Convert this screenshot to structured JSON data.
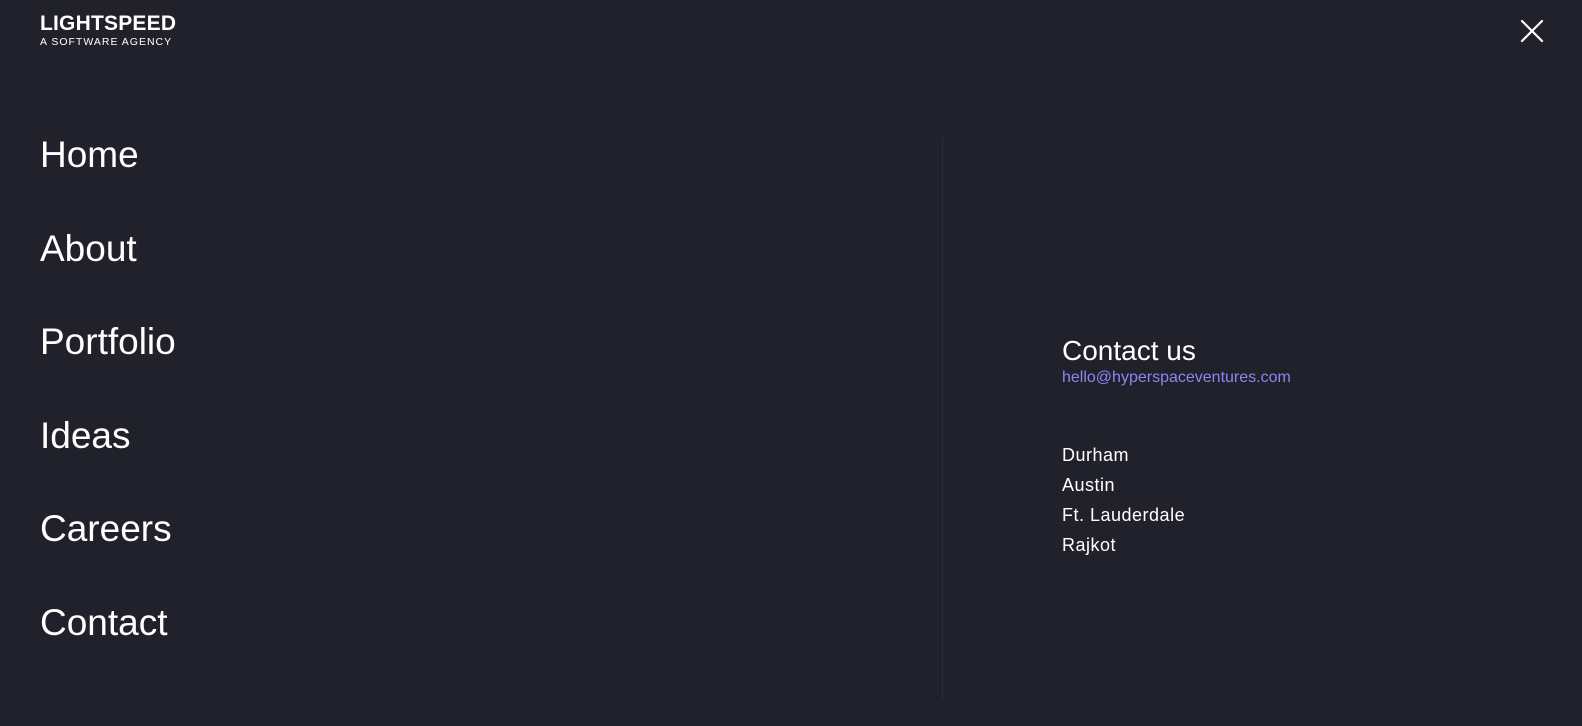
{
  "logo": {
    "name": "LIGHTSPEED",
    "tagline": "A SOFTWARE AGENCY"
  },
  "close_icon": "close-icon",
  "nav": {
    "items": [
      {
        "label": "Home"
      },
      {
        "label": "About"
      },
      {
        "label": "Portfolio"
      },
      {
        "label": "Ideas"
      },
      {
        "label": "Careers"
      },
      {
        "label": "Contact"
      }
    ]
  },
  "contact": {
    "heading": "Contact us",
    "email": "hello@hyperspaceventures.com"
  },
  "locations": [
    "Durham",
    "Austin",
    "Ft. Lauderdale",
    "Rajkot"
  ],
  "colors": {
    "background": "#20212a",
    "text": "#ffffff",
    "link": "#8b86f4",
    "divider": "#2d2e38"
  }
}
